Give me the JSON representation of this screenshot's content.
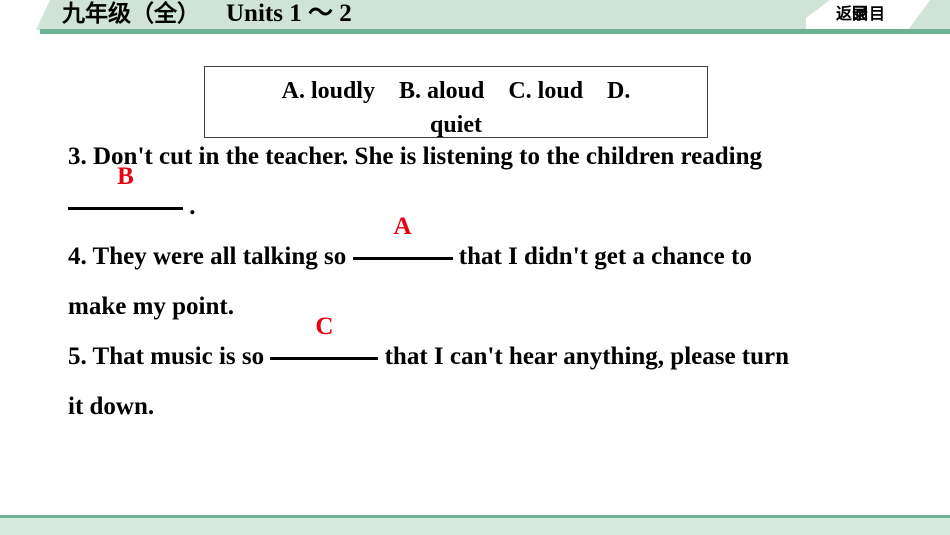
{
  "header": {
    "title_cn": "九年级（全）",
    "title_en": "Units 1 ～ 2",
    "back_button": "返回目录",
    "back_button_chars": [
      "返",
      "回",
      "录",
      "目"
    ],
    "band_color": "#cfe3d6",
    "rule_color": "#6bb392"
  },
  "option_box": {
    "options": [
      {
        "label": "A.",
        "text": "loudly"
      },
      {
        "label": "B.",
        "text": "aloud"
      },
      {
        "label": "C.",
        "text": "loud"
      },
      {
        "label": "D.",
        "text": "quiet"
      }
    ],
    "line1": "A. loudly　B. aloud　C. loud　D.",
    "line2": "quiet"
  },
  "questions": [
    {
      "number": "3.",
      "line1_before": "3. Don't cut in the teacher. She is listening to the children reading",
      "line2_before": "",
      "answer": "B",
      "line2_after": "."
    },
    {
      "number": "4.",
      "line1_before": "4. They were all talking so",
      "answer": "A",
      "line1_after": "that I didn't get a chance to",
      "line2": "make my point."
    },
    {
      "number": "5.",
      "line1_before": "5. That music is so",
      "answer": "C",
      "line1_after": "that I can't hear anything, please turn",
      "line2": "it down."
    }
  ],
  "colors": {
    "answer_red": "#e60012",
    "footer_fill": "#d8e9de",
    "footer_border": "#6bb392"
  }
}
